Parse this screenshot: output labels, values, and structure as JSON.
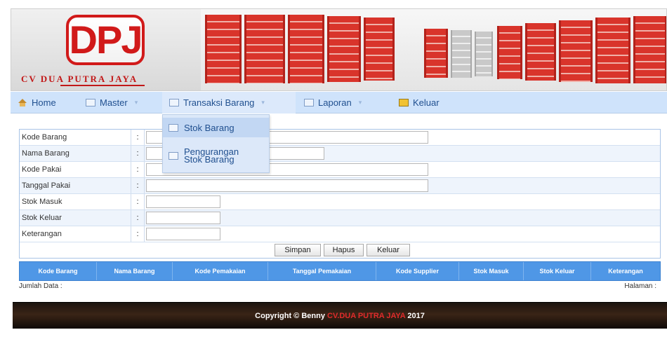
{
  "header": {
    "logo_text": "DPJ",
    "company_name": "CV DUA PUTRA JAYA"
  },
  "nav": {
    "items": [
      {
        "label": "Home",
        "icon": "home-icon"
      },
      {
        "label": "Master",
        "icon": "grid-icon"
      },
      {
        "label": "Transaksi Barang",
        "icon": "book-icon"
      },
      {
        "label": "Laporan",
        "icon": "report-icon"
      },
      {
        "label": "Keluar",
        "icon": "exit-icon"
      }
    ],
    "dropdown": {
      "items": [
        {
          "label": "Stok Barang",
          "icon": "book-icon"
        },
        {
          "label_line1": "Pengurangan",
          "label_line2": "Stok Barang",
          "icon": "report-icon"
        }
      ]
    }
  },
  "form": {
    "separator": ":",
    "fields": [
      {
        "label": "Kode Barang",
        "value": ""
      },
      {
        "label": "Nama Barang",
        "value": ""
      },
      {
        "label": "Kode Pakai",
        "value": ""
      },
      {
        "label": "Tanggal Pakai",
        "value": ""
      },
      {
        "label": "Stok Masuk",
        "value": ""
      },
      {
        "label": "Stok Keluar",
        "value": ""
      },
      {
        "label": "Keterangan",
        "value": ""
      }
    ],
    "buttons": {
      "save": "Simpan",
      "delete": "Hapus",
      "exit": "Keluar"
    }
  },
  "table": {
    "columns": [
      "Kode Barang",
      "Nama Barang",
      "Kode Pemakaian",
      "Tanggal Pemakaian",
      "Kode Supplier",
      "Stok Masuk",
      "Stok Keluar",
      "Keterangan"
    ]
  },
  "summary": {
    "count_label": "Jumlah Data :",
    "page_label": "Halaman :"
  },
  "footer": {
    "prefix": "Copyright © Benny",
    "brand": "CV.DUA PUTRA JAYA",
    "year": "2017"
  },
  "colors": {
    "brand_red": "#d11a1a",
    "nav_bg": "#cfe3fb",
    "table_header": "#4f97e6"
  }
}
